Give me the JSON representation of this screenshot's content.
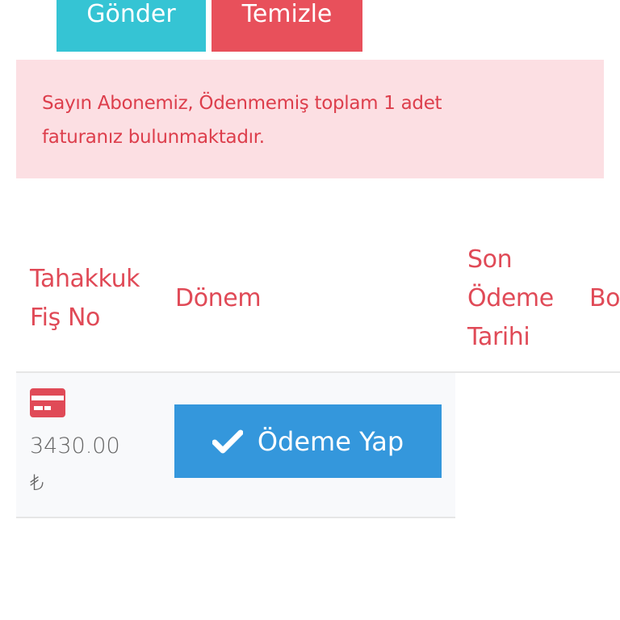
{
  "actions": {
    "send_label": "Gönder",
    "clear_label": "Temizle"
  },
  "alert": {
    "line1": "Sayın Abonemiz, Ödenmemiş toplam 1 adet",
    "line2": "faturanız bulunmaktadır."
  },
  "table": {
    "headers": {
      "fis_no_line1": "Tahakkuk",
      "fis_no_line2": "Fiş No",
      "donem": "Dönem",
      "son_odeme_line1": "Son",
      "son_odeme_line2": "Ödeme",
      "son_odeme_line3": "Tarihi",
      "borc_partial": "Bo"
    },
    "rows": [
      {
        "icon": "credit-card-icon",
        "amount_line1": "3430.00",
        "amount_line2": "₺",
        "pay_label": "Ödeme Yap"
      }
    ]
  },
  "colors": {
    "teal": "#35c4d4",
    "red": "#e8505b",
    "alert_bg": "#fcdfe3",
    "header_text": "#e04a57",
    "pay_blue": "#3497dc"
  }
}
